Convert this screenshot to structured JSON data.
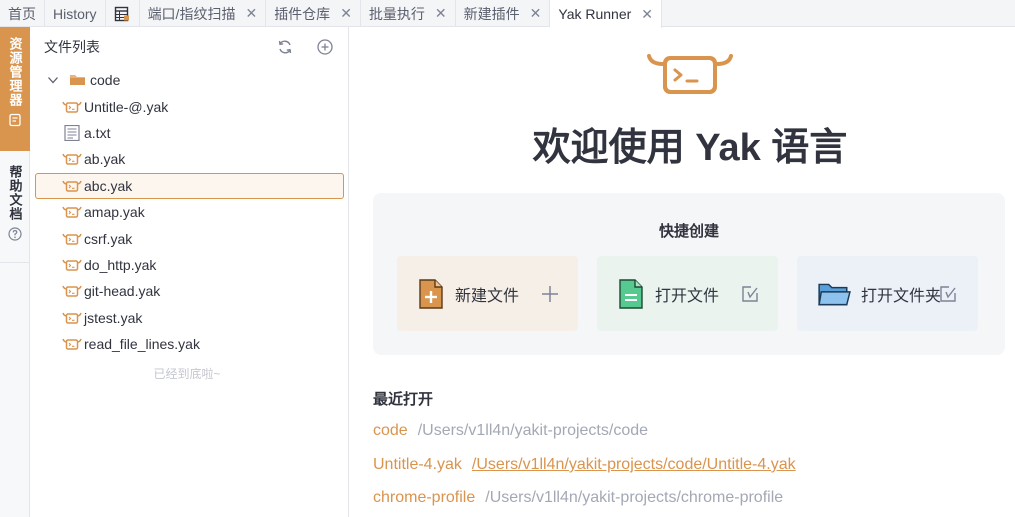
{
  "tabs": [
    {
      "label": "首页",
      "closable": false
    },
    {
      "label": "History",
      "closable": false
    },
    {
      "label": "",
      "icon": "table-icon",
      "closable": false
    },
    {
      "label": "端口/指纹扫描",
      "closable": true
    },
    {
      "label": "插件仓库",
      "closable": true
    },
    {
      "label": "批量执行",
      "closable": true
    },
    {
      "label": "新建插件",
      "closable": true
    },
    {
      "label": "Yak Runner",
      "closable": true,
      "active": true
    }
  ],
  "close_glyph": "✕",
  "side_tabs": {
    "explorer": "资源管理器",
    "help": "帮助文档"
  },
  "file_panel": {
    "title": "文件列表",
    "folder": "code",
    "files": [
      {
        "name": "Untitle-@.yak",
        "type": "yak"
      },
      {
        "name": "a.txt",
        "type": "txt"
      },
      {
        "name": "ab.yak",
        "type": "yak"
      },
      {
        "name": "abc.yak",
        "type": "yak",
        "selected": true
      },
      {
        "name": "amap.yak",
        "type": "yak"
      },
      {
        "name": "csrf.yak",
        "type": "yak"
      },
      {
        "name": "do_http.yak",
        "type": "yak"
      },
      {
        "name": "git-head.yak",
        "type": "yak"
      },
      {
        "name": "jstest.yak",
        "type": "yak"
      },
      {
        "name": "read_file_lines.yak",
        "type": "yak"
      }
    ],
    "end_note": "已经到底啦~"
  },
  "welcome": {
    "title": "欢迎使用 Yak 语言",
    "quick_title": "快捷创建",
    "cards": {
      "new_file": "新建文件",
      "open_file": "打开文件",
      "open_folder": "打开文件夹"
    },
    "recent_title": "最近打开",
    "recent": [
      {
        "name": "code",
        "path": "/Users/v1ll4n/yakit-projects/code"
      },
      {
        "name": "Untitle-4.yak",
        "path": "/Users/v1ll4n/yakit-projects/code/Untitle-4.yak"
      },
      {
        "name": "chrome-profile",
        "path": "/Users/v1ll4n/yakit-projects/chrome-profile"
      }
    ]
  },
  "colors": {
    "accent": "#d9944e",
    "muted": "#a4a8b5",
    "green": "#56c991",
    "blue": "#7ab0e0"
  }
}
